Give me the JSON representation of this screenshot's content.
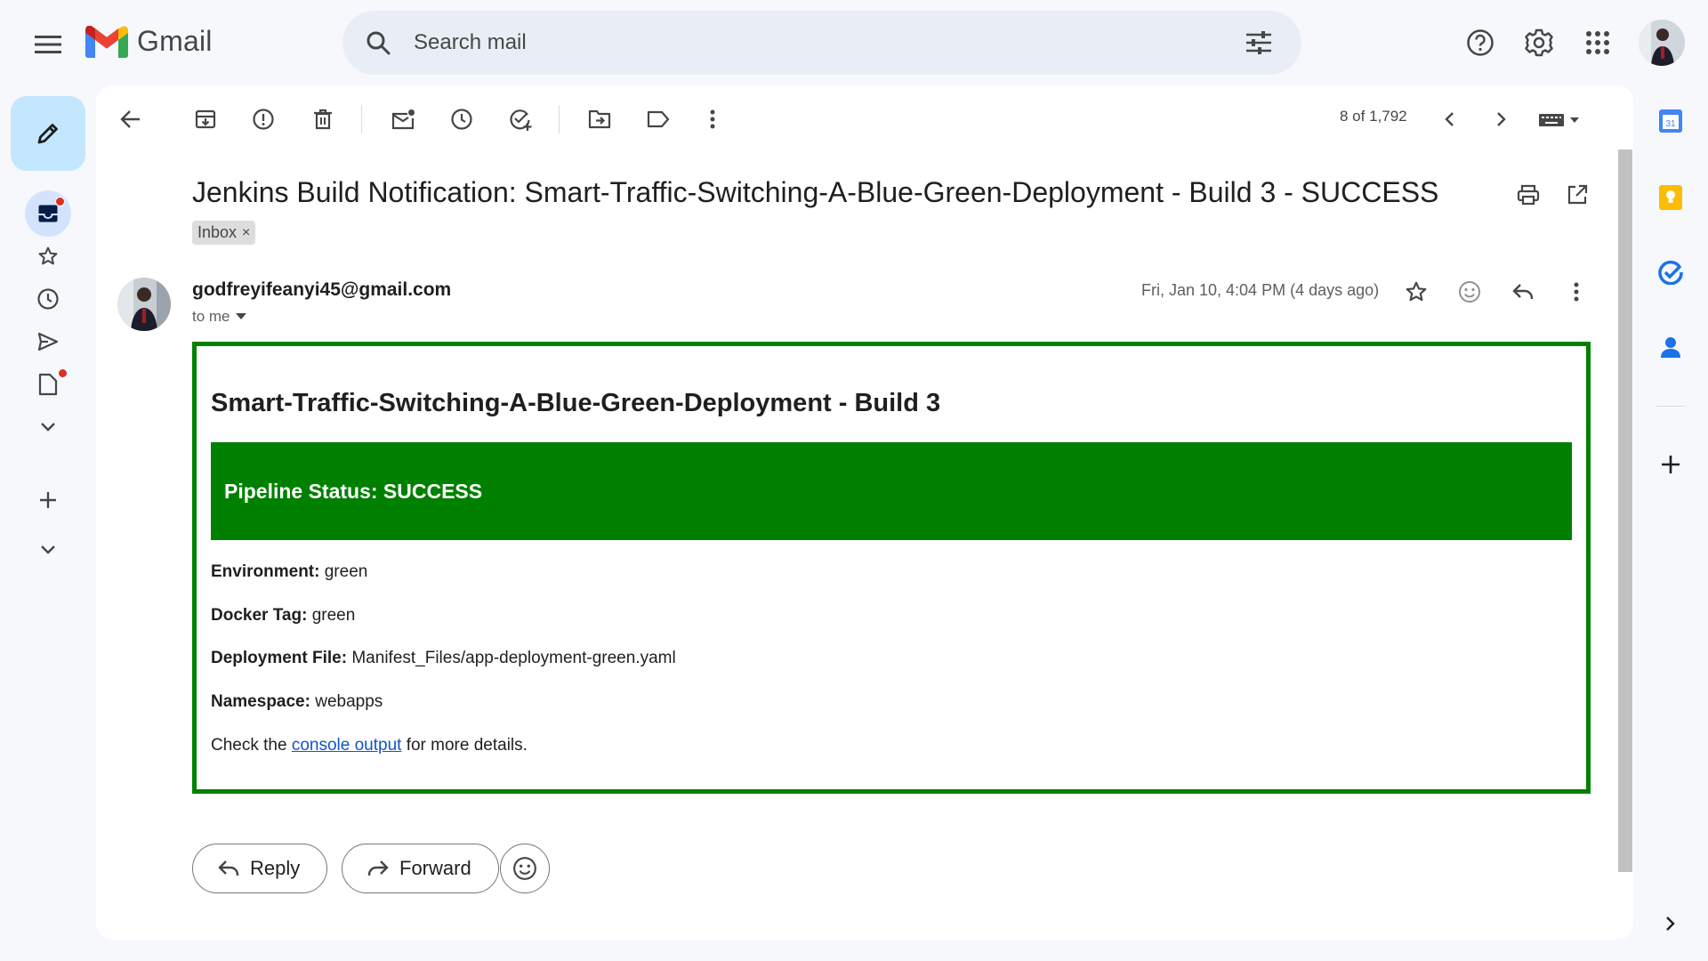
{
  "app": {
    "logo_text": "Gmail",
    "search_placeholder": "Search mail"
  },
  "toolbar": {
    "pager": "8 of 1,792"
  },
  "email": {
    "subject": "Jenkins Build Notification: Smart-Traffic-Switching-A-Blue-Green-Deployment - Build 3 - SUCCESS",
    "label": "Inbox",
    "label_remove": "×",
    "sender": "godfreyifeanyi45@gmail.com",
    "recipient": "to me",
    "date": "Fri, Jan 10, 4:04 PM (4 days ago)",
    "body": {
      "title": "Smart-Traffic-Switching-A-Blue-Green-Deployment - Build 3",
      "status": "Pipeline Status: SUCCESS",
      "fields": [
        {
          "label": "Environment:",
          "value": "green"
        },
        {
          "label": "Docker Tag:",
          "value": "green"
        },
        {
          "label": "Deployment File:",
          "value": "Manifest_Files/app-deployment-green.yaml"
        },
        {
          "label": "Namespace:",
          "value": "webapps"
        }
      ],
      "footer_prefix": "Check the",
      "footer_link": "console output",
      "footer_suffix": "for more details."
    }
  },
  "actions": {
    "reply": "Reply",
    "forward": "Forward"
  },
  "colors": {
    "accent_green": "#008000",
    "link": "#1155cc",
    "compose_bg": "#c2e7ff",
    "unread_dot": "#d93025"
  },
  "icons": {
    "left_rail": [
      "inbox-icon",
      "star-icon",
      "clock-icon",
      "send-icon",
      "draft-icon",
      "chevron-down-icon",
      "plus-icon",
      "chevron-down-icon"
    ],
    "right_rail": [
      "calendar-icon",
      "keep-icon",
      "tasks-icon",
      "contacts-icon",
      "plus-icon",
      "chevron-right-icon"
    ]
  }
}
